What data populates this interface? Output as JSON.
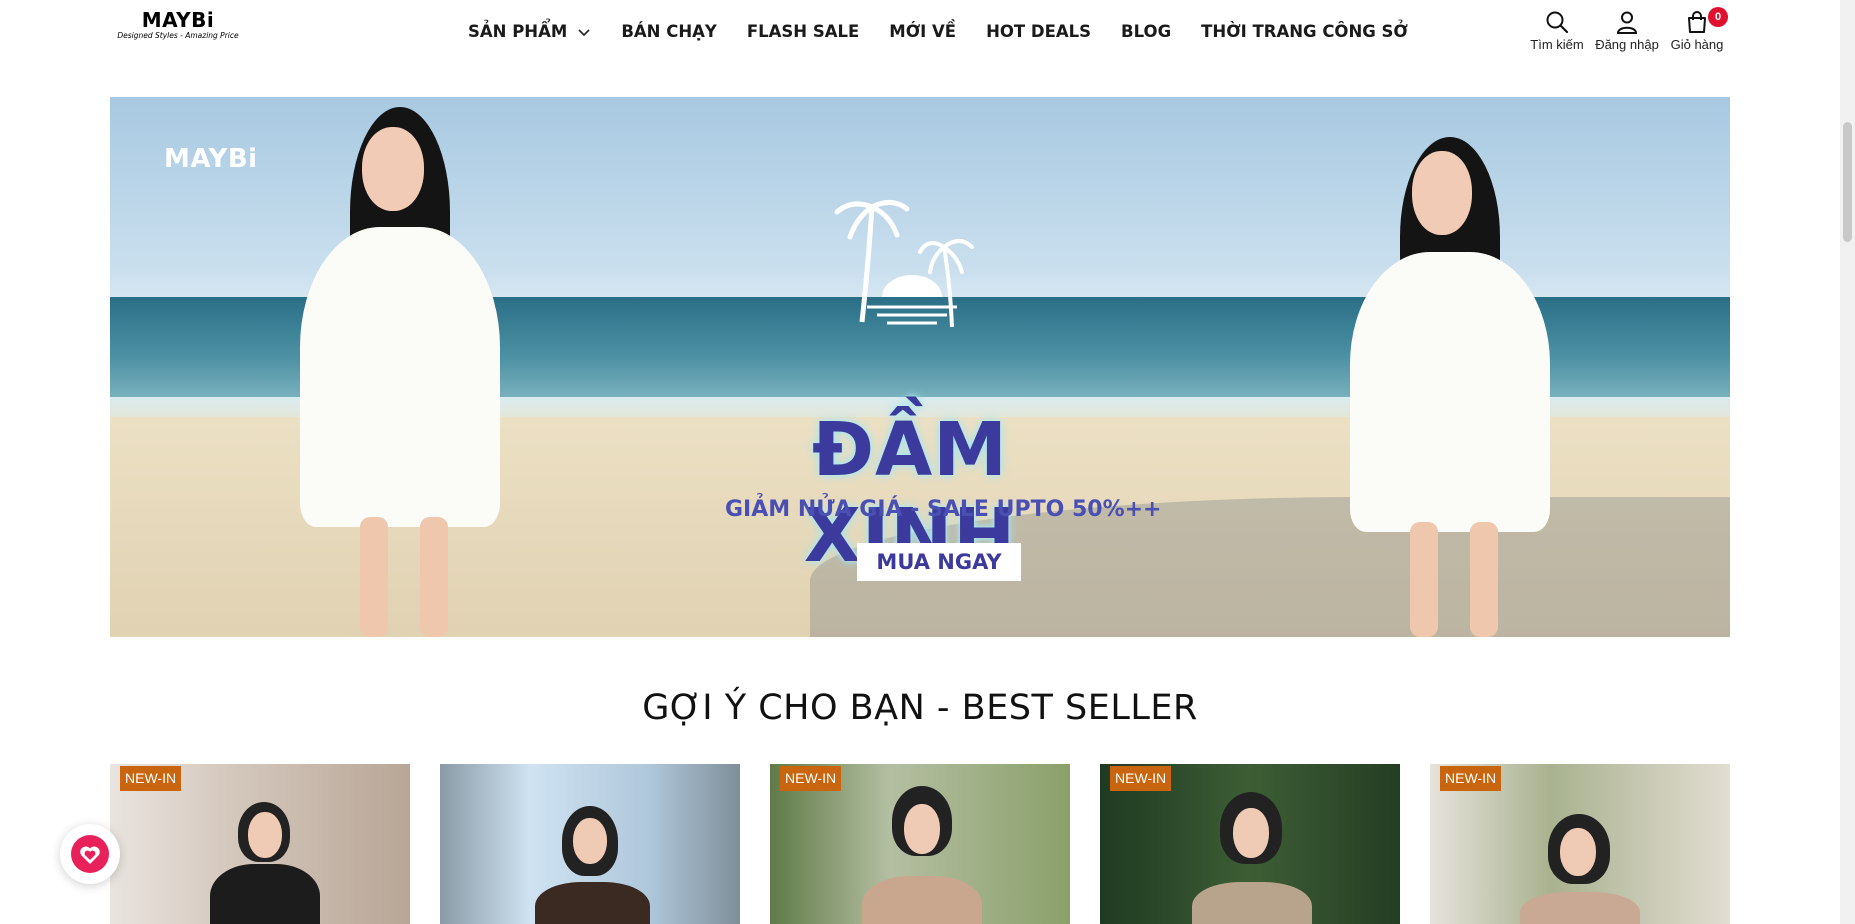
{
  "brand": {
    "name": "MAYBi",
    "tagline": "Designed Styles - Amazing Price"
  },
  "nav": {
    "items": [
      {
        "label": "SẢN PHẨM",
        "has_dropdown": true
      },
      {
        "label": "BÁN CHẠY"
      },
      {
        "label": "FLASH SALE"
      },
      {
        "label": "MỚI VỀ"
      },
      {
        "label": "HOT DEALS"
      },
      {
        "label": "BLOG"
      },
      {
        "label": "THỜI TRANG CÔNG SỞ"
      }
    ]
  },
  "actions": {
    "search_label": "Tìm kiếm",
    "login_label": "Đăng nhập",
    "cart_label": "Giỏ hàng",
    "cart_count": "0"
  },
  "banner": {
    "logo": "MAYBi",
    "headline": "ĐẦM XINH",
    "subline": "GIẢM NỬA GIÁ - SALE UPTO 50%++",
    "cta": "MUA NGAY"
  },
  "section": {
    "title": "GỢI Ý CHO BẠN - BEST SELLER"
  },
  "products": [
    {
      "badge": "NEW-IN"
    },
    {
      "badge": ""
    },
    {
      "badge": "NEW-IN"
    },
    {
      "badge": "NEW-IN"
    },
    {
      "badge": "NEW-IN"
    }
  ],
  "colors": {
    "badge": "#c8650e",
    "cart_badge": "#e0102f",
    "headline": "#3c3b9d",
    "wishlist": "#e8215a"
  },
  "icons": {
    "search": "search-icon",
    "login": "user-icon",
    "cart": "cart-icon",
    "wishlist": "heart-icon",
    "dropdown": "chevron-down-icon"
  }
}
